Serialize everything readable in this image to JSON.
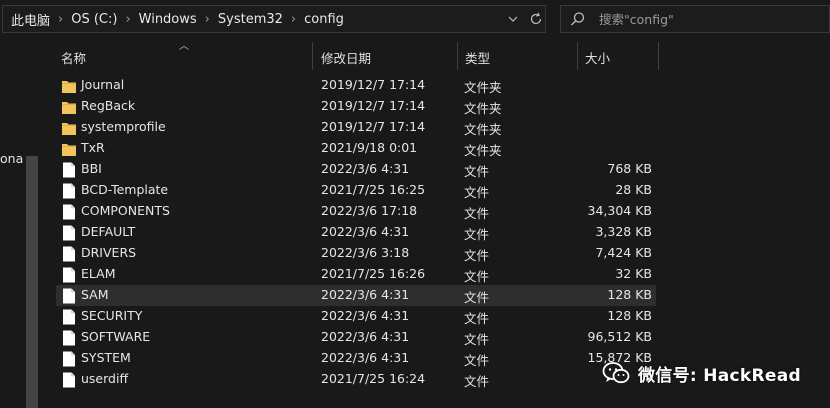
{
  "address_bar": {
    "crumbs": [
      "此电脑",
      "OS (C:)",
      "Windows",
      "System32",
      "config"
    ]
  },
  "search": {
    "placeholder": "搜索\"config\""
  },
  "nav_pane": {
    "partial_label": "ona"
  },
  "columns": {
    "name": "名称",
    "date": "修改日期",
    "type": "类型",
    "size": "大小"
  },
  "files": [
    {
      "name": "Journal",
      "date": "2019/12/7 17:14",
      "type": "文件夹",
      "size": "",
      "kind": "folder"
    },
    {
      "name": "RegBack",
      "date": "2019/12/7 17:14",
      "type": "文件夹",
      "size": "",
      "kind": "folder"
    },
    {
      "name": "systemprofile",
      "date": "2019/12/7 17:14",
      "type": "文件夹",
      "size": "",
      "kind": "folder"
    },
    {
      "name": "TxR",
      "date": "2021/9/18 0:01",
      "type": "文件夹",
      "size": "",
      "kind": "folder"
    },
    {
      "name": "BBI",
      "date": "2022/3/6 4:31",
      "type": "文件",
      "size": "768 KB",
      "kind": "file"
    },
    {
      "name": "BCD-Template",
      "date": "2021/7/25 16:25",
      "type": "文件",
      "size": "28 KB",
      "kind": "file"
    },
    {
      "name": "COMPONENTS",
      "date": "2022/3/6 17:18",
      "type": "文件",
      "size": "34,304 KB",
      "kind": "file"
    },
    {
      "name": "DEFAULT",
      "date": "2022/3/6 4:31",
      "type": "文件",
      "size": "3,328 KB",
      "kind": "file"
    },
    {
      "name": "DRIVERS",
      "date": "2022/3/6 3:18",
      "type": "文件",
      "size": "7,424 KB",
      "kind": "file"
    },
    {
      "name": "ELAM",
      "date": "2021/7/25 16:26",
      "type": "文件",
      "size": "32 KB",
      "kind": "file"
    },
    {
      "name": "SAM",
      "date": "2022/3/6 4:31",
      "type": "文件",
      "size": "128 KB",
      "kind": "file",
      "selected": true
    },
    {
      "name": "SECURITY",
      "date": "2022/3/6 4:31",
      "type": "文件",
      "size": "128 KB",
      "kind": "file"
    },
    {
      "name": "SOFTWARE",
      "date": "2022/3/6 4:31",
      "type": "文件",
      "size": "96,512 KB",
      "kind": "file"
    },
    {
      "name": "SYSTEM",
      "date": "2022/3/6 4:31",
      "type": "文件",
      "size": "15,872 KB",
      "kind": "file"
    },
    {
      "name": "userdiff",
      "date": "2021/7/25 16:24",
      "type": "文件",
      "size": "",
      "kind": "file"
    }
  ],
  "watermark": {
    "text": "微信号: HackRead"
  },
  "colors": {
    "background": "#191919",
    "folder": "#f2c55c",
    "selected_row": "#2e2e2e"
  }
}
